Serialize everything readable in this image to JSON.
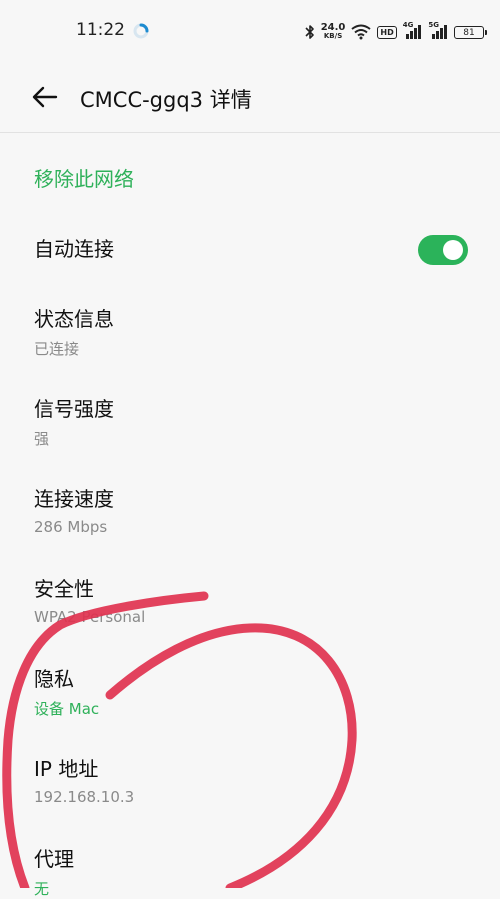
{
  "status_bar": {
    "time": "11:22",
    "net_speed_value": "24.0",
    "net_speed_unit": "KB/S",
    "hd_badge": "HD",
    "sim1_label": "4G",
    "sim2_label": "5G",
    "battery_level": "81",
    "icons": [
      "loading-circle-icon",
      "bluetooth-icon",
      "wifi-icon",
      "signal-icon",
      "battery-icon"
    ]
  },
  "header": {
    "title": "CMCC-ggq3 详情",
    "back_icon": "back-arrow-icon"
  },
  "actions": {
    "remove_network": "移除此网络"
  },
  "auto_connect": {
    "label": "自动连接",
    "enabled": true
  },
  "details": [
    {
      "label": "状态信息",
      "value": "已连接"
    },
    {
      "label": "信号强度",
      "value": "强"
    },
    {
      "label": "连接速度",
      "value": "286 Mbps"
    },
    {
      "label": "安全性",
      "value": "WPA2 Personal"
    },
    {
      "label": "隐私",
      "value": "设备 Mac"
    },
    {
      "label": "IP 地址",
      "value": "192.168.10.3"
    },
    {
      "label": "代理",
      "value": "无"
    }
  ],
  "colors": {
    "accent_green": "#2fb15a",
    "annotation_red": "#e0324f",
    "background": "#f7f7f7"
  }
}
